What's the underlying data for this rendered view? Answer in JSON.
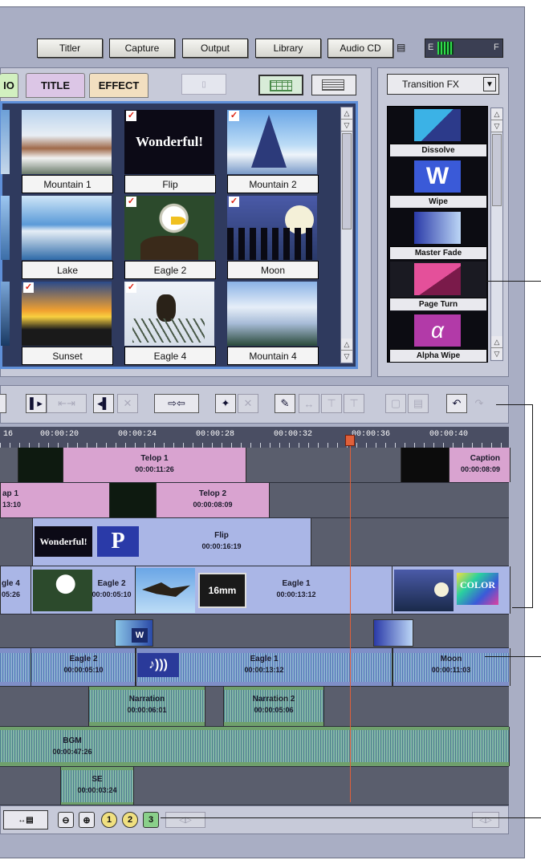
{
  "menu": {
    "titler": "Titler",
    "capture": "Capture",
    "output": "Output",
    "library": "Library",
    "audio_cd": "Audio CD",
    "meter_left": "E",
    "meter_right": "F"
  },
  "album": {
    "tabs": [
      "IO",
      "TITLE",
      "EFFECT"
    ],
    "view_icons": [
      "grid-view-icon",
      "list-view-icon"
    ],
    "thumbs": [
      {
        "label": "Mountain 1",
        "checked": false
      },
      {
        "label": "Flip",
        "checked": true,
        "text": "Wonderful!"
      },
      {
        "label": "Mountain 2",
        "checked": true
      },
      {
        "label": "Lake",
        "checked": false
      },
      {
        "label": "Eagle 2",
        "checked": true
      },
      {
        "label": "Moon",
        "checked": true
      },
      {
        "label": "Sunset",
        "checked": true
      },
      {
        "label": "Eagle 4",
        "checked": true
      },
      {
        "label": "Mountain 4",
        "checked": false
      }
    ]
  },
  "transitions": {
    "dropdown": "Transition FX",
    "items": [
      "Dissolve",
      "Wipe",
      "Master Fade",
      "Page Turn",
      "Alpha Wipe"
    ]
  },
  "timeline": {
    "ticks": [
      "16",
      "00:00:20",
      "00:00:24",
      "00:00:28",
      "00:00:32",
      "00:00:36",
      "00:00:40"
    ],
    "track1": [
      {
        "name": "Telop 1",
        "tc": "00:00:11:26"
      },
      {
        "name": "Caption",
        "tc": "00:00:08:09"
      }
    ],
    "track2": [
      {
        "name": "ap 1",
        "tc": "13:10"
      },
      {
        "name": "Telop 2",
        "tc": "00:00:08:09"
      }
    ],
    "track3": [
      {
        "name": "Flip",
        "tc": "00:00:16:19",
        "thumb_text": "Wonderful!"
      }
    ],
    "track4": [
      {
        "name": "gle 4",
        "tc": "05:26"
      },
      {
        "name": "Eagle 2",
        "tc": "00:00:05:10"
      },
      {
        "name": "Eagle 1",
        "tc": "00:00:13:12"
      }
    ],
    "audio1": [
      {
        "name": "Eagle 2",
        "tc": "00:00:05:10"
      },
      {
        "name": "Eagle 1",
        "tc": "00:00:13:12"
      },
      {
        "name": "Moon",
        "tc": "00:00:11:03"
      }
    ],
    "narr": [
      {
        "name": "Narration",
        "tc": "00:00:06:01"
      },
      {
        "name": "Narration 2",
        "tc": "00:00:05:06"
      }
    ],
    "bgm": {
      "name": "BGM",
      "tc": "00:00:47:26"
    },
    "se": {
      "name": "SE",
      "tc": "00:00:03:24"
    },
    "film_label": "16mm",
    "color_label": "COLOR"
  },
  "bottom": {
    "zoom_levels": [
      "1",
      "2",
      "3"
    ]
  },
  "colors": {
    "accent": "#5f8fd8",
    "playhead": "#e0603a",
    "title_clip": "#d9a3d0",
    "video_clip": "#aab6e6"
  }
}
